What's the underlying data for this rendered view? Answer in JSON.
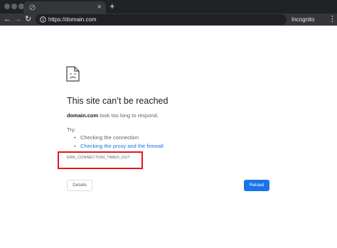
{
  "browser": {
    "tab": {
      "icon": "globe-icon",
      "close_label": "×"
    },
    "new_tab_label": "+",
    "nav": {
      "back": "←",
      "forward": "→",
      "reload": "↻"
    },
    "address": {
      "icon": "info-icon",
      "url": "https://domain.com"
    },
    "incognito_label": "Incognito",
    "menu_label": "⋮"
  },
  "error_page": {
    "icon": "sad-document-icon",
    "title": "This site can’t be reached",
    "description": {
      "domain": "domain.com",
      "message": " took too long to respond."
    },
    "try_label": "Try:",
    "suggestions": [
      {
        "text": "Checking the connection"
      },
      {
        "text": "Checking the proxy and the firewall"
      }
    ],
    "error_code": "ERR_CONNECTION_TIMED_OUT",
    "buttons": {
      "details": "Details",
      "reload": "Reload"
    }
  },
  "colors": {
    "chrome_dark": "#202124",
    "chrome_toolbar": "#35363a",
    "link_blue": "#1a73e8",
    "primary_button": "#1a73e8",
    "highlight_red": "#e3161c"
  }
}
